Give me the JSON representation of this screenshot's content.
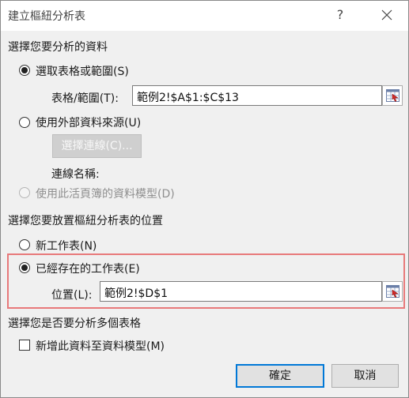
{
  "window": {
    "title": "建立樞紐分析表",
    "help_glyph": "?"
  },
  "section1": {
    "heading": "選擇您要分析的資料",
    "option_select_table": "選取表格或範圍(S)",
    "table_range_label": "表格/範圍(T):",
    "table_range_value": "範例2!$A$1:$C$13",
    "option_external": "使用外部資料來源(U)",
    "choose_connection_button": "選擇連線(C)...",
    "connection_name_label": "連線名稱:",
    "option_data_model": "使用此活頁簿的資料模型(D)"
  },
  "section2": {
    "heading": "選擇您要放置樞紐分析表的位置",
    "option_new_sheet": "新工作表(N)",
    "option_existing_sheet": "已經存在的工作表(E)",
    "location_label": "位置(L):",
    "location_value": "範例2!$D$1"
  },
  "section3": {
    "heading": "選擇您是否要分析多個表格",
    "checkbox_add_to_model": "新增此資料至資料模型(M)"
  },
  "footer": {
    "ok_label": "確定",
    "cancel_label": "取消"
  },
  "state": {
    "selected_source": "select_table",
    "selected_location": "existing_sheet",
    "add_to_data_model": false
  },
  "colors": {
    "highlight_border": "#e8797a",
    "default_button_border": "#0078d7"
  },
  "icons": [
    "close-icon",
    "range-selector-icon"
  ]
}
